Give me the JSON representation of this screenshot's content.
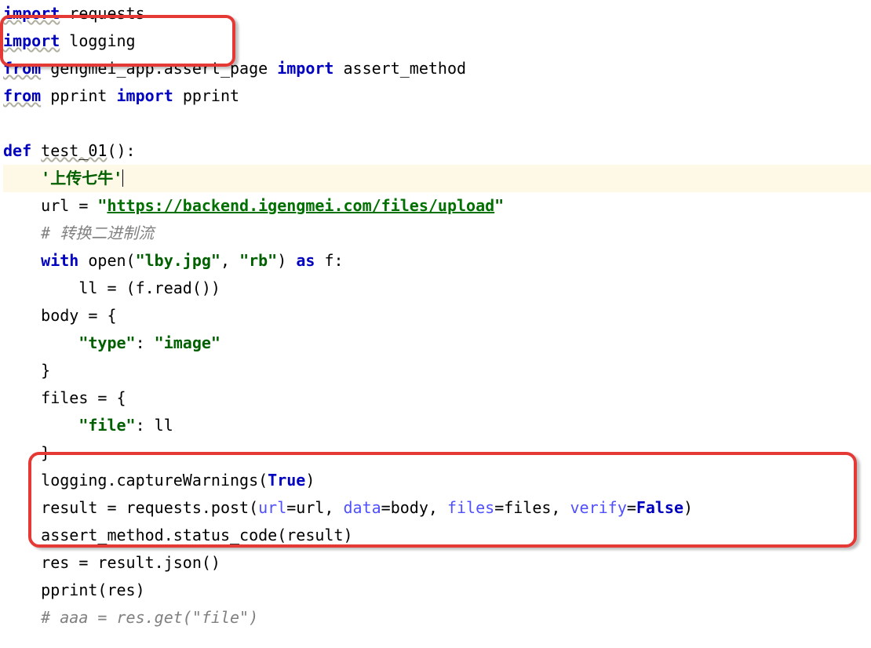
{
  "code": {
    "l1_import": "import",
    "l1_requests": "requests",
    "l2_import": "import",
    "l2_logging": "logging",
    "l3_from": "from",
    "l3_pkg": "gengmei_app.assert_page",
    "l3_import": "import",
    "l3_mod": "assert_method",
    "l4_from": "from",
    "l4_pprint1": "pprint",
    "l4_import": "import",
    "l4_pprint2": "pprint",
    "l6_def": "def",
    "l6_name": "test_01",
    "l6_paren": "():",
    "l7_docstring": "'上传七牛'",
    "l8_url_assign": "url = ",
    "l8_q": "\"",
    "l8_url": "https://backend.igengmei.com/files/upload",
    "l9_comment": "# 转换二进制流",
    "l10_with": "with",
    "l10_open": " open(",
    "l10_file": "\"lby.jpg\"",
    "l10_comma": ", ",
    "l10_mode": "\"rb\"",
    "l10_paren": ") ",
    "l10_as": "as",
    "l10_f": " f:",
    "l11": "ll = (f.read())",
    "l12": "body = {",
    "l13_key": "\"type\"",
    "l13_colon": ": ",
    "l13_val": "\"image\"",
    "l14": "}",
    "l15": "files = {",
    "l16_key": "\"file\"",
    "l16_colon": ": ll",
    "l17": "}",
    "l18_pre": "logging.captureWarnings(",
    "l18_true": "True",
    "l18_post": ")",
    "l19_pre": "result = requests.post(",
    "l19_p1": "url",
    "l19_e1": "=url, ",
    "l19_p2": "data",
    "l19_e2": "=body, ",
    "l19_p3": "files",
    "l19_e3": "=files, ",
    "l19_p4": "verify",
    "l19_e4": "=",
    "l19_false": "False",
    "l19_post": ")",
    "l20": "assert_method.status_code(result)",
    "l21": "res = result.json()",
    "l22": "pprint(res)",
    "l23": "# aaa = res.get(\"file\")"
  }
}
